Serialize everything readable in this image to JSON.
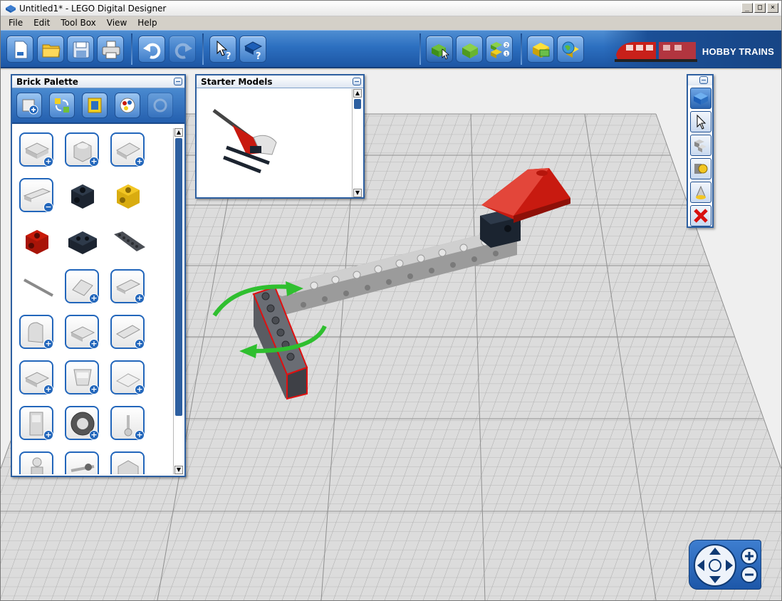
{
  "window": {
    "title": "Untitled1* - LEGO Digital Designer",
    "controls": [
      "_",
      "□",
      "×"
    ]
  },
  "menu": [
    "File",
    "Edit",
    "Tool Box",
    "View",
    "Help"
  ],
  "toolbar": {
    "buttons": [
      "new-icon",
      "open-icon",
      "save-icon",
      "print-icon",
      "undo-icon",
      "redo-icon",
      "select-help-icon",
      "book-help-icon",
      "build-mode-icon",
      "view-mode-icon",
      "building-guide-icon",
      "order-icon",
      "share-online-icon"
    ],
    "brand_label": "HOBBY TRAINS",
    "accent": "#2c6fc0"
  },
  "brick_palette": {
    "title": "Brick Palette",
    "tools": [
      "add-group-icon",
      "swap-icon",
      "filter-icon",
      "color-icon",
      "refresh-icon"
    ],
    "bricks": [
      {
        "name": "plate-2x2",
        "color": "#d8d8d8",
        "badge": "+"
      },
      {
        "name": "brick-1x1-round",
        "color": "#d8d8d8",
        "badge": "+"
      },
      {
        "name": "plate-2x2-corner",
        "color": "#d8d8d8",
        "badge": "+"
      },
      {
        "name": "plate-1x4",
        "color": "#d8d8d8",
        "badge": "−"
      },
      {
        "name": "technic-brick-1x1-black",
        "color": "#1c2430",
        "badge": ""
      },
      {
        "name": "technic-brick-1x1-yellow",
        "color": "#f2c623",
        "badge": ""
      },
      {
        "name": "technic-brick-1x1-red",
        "color": "#c91a09",
        "badge": ""
      },
      {
        "name": "technic-brick-1x2-black",
        "color": "#1c2430",
        "badge": ""
      },
      {
        "name": "technic-beam-1x8-dark",
        "color": "#4a4e55",
        "badge": ""
      },
      {
        "name": "axle-long",
        "color": "#9a9a9a",
        "badge": ""
      },
      {
        "name": "slope-2x2",
        "color": "#d8d8d8",
        "badge": "+"
      },
      {
        "name": "plate-2x3-wedge",
        "color": "#d8d8d8",
        "badge": "+"
      },
      {
        "name": "arch-1x2",
        "color": "#d8d8d8",
        "badge": "+"
      },
      {
        "name": "plate-2x2-jumper",
        "color": "#d8d8d8",
        "badge": "+"
      },
      {
        "name": "wing-plate",
        "color": "#d8d8d8",
        "badge": "+"
      },
      {
        "name": "plate-modified",
        "color": "#d8d8d8",
        "badge": "+"
      },
      {
        "name": "slope-inverted",
        "color": "#d8d8d8",
        "badge": "+"
      },
      {
        "name": "hinge-plate",
        "color": "#d8d8d8",
        "badge": "+"
      },
      {
        "name": "door-panel",
        "color": "#d8d8d8",
        "badge": "+"
      },
      {
        "name": "tire-wheel",
        "color": "#555555",
        "badge": "+"
      },
      {
        "name": "tool-wrench",
        "color": "#d8d8d8",
        "badge": "+"
      },
      {
        "name": "minifigure",
        "color": "#d8d8d8",
        "badge": ""
      },
      {
        "name": "axle-with-wheel",
        "color": "#d8d8d8",
        "badge": ""
      },
      {
        "name": "brick-1x2-half",
        "color": "#d8d8d8",
        "badge": ""
      }
    ]
  },
  "starter_models": {
    "title": "Starter Models",
    "models": [
      "helicopter-model"
    ]
  },
  "tool_strip": {
    "tools": [
      "brick-icon",
      "select-icon",
      "clone-icon",
      "hinge-icon",
      "paint-icon",
      "delete-icon"
    ]
  },
  "nav_control": {
    "buttons": [
      "rotate-up-icon",
      "rotate-down-icon",
      "rotate-left-icon",
      "rotate-right-icon",
      "reset-view-icon",
      "zoom-in-icon",
      "zoom-out-icon"
    ]
  }
}
